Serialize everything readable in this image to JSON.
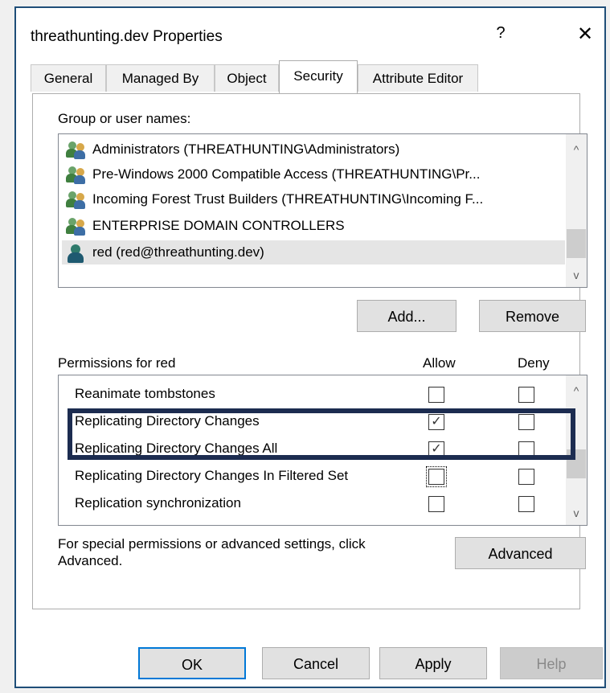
{
  "window": {
    "title": "threathunting.dev Properties",
    "help_glyph": "?",
    "close_glyph": "✕"
  },
  "tabs": [
    {
      "label": "General"
    },
    {
      "label": "Managed By"
    },
    {
      "label": "Object"
    },
    {
      "label": "Security"
    },
    {
      "label": "Attribute Editor"
    }
  ],
  "active_tab": "Security",
  "security": {
    "group_label": "Group or user names:",
    "principals": [
      {
        "name": "Administrators (THREATHUNTING\\Administrators)",
        "icon": "group-icon"
      },
      {
        "name": "Pre-Windows 2000 Compatible Access (THREATHUNTING\\Pr...",
        "icon": "group-icon"
      },
      {
        "name": "Incoming Forest Trust Builders (THREATHUNTING\\Incoming F...",
        "icon": "group-icon"
      },
      {
        "name": "ENTERPRISE DOMAIN CONTROLLERS",
        "icon": "group-icon"
      },
      {
        "name": "red (red@threathunting.dev)",
        "icon": "user-icon"
      }
    ],
    "add_label": "Add...",
    "remove_label": "Remove",
    "permissions_label": "Permissions for red",
    "allow_header": "Allow",
    "deny_header": "Deny",
    "permissions": [
      {
        "name": "Reanimate tombstones",
        "allow": false,
        "deny": false
      },
      {
        "name": "Replicating Directory Changes",
        "allow": true,
        "deny": false
      },
      {
        "name": "Replicating Directory Changes All",
        "allow": true,
        "deny": false
      },
      {
        "name": "Replicating Directory Changes In Filtered Set",
        "allow": false,
        "deny": false
      },
      {
        "name": "Replication synchronization",
        "allow": false,
        "deny": false
      }
    ],
    "advanced_note": "For special permissions or advanced settings, click Advanced.",
    "advanced_label": "Advanced"
  },
  "buttons": {
    "ok": "OK",
    "cancel": "Cancel",
    "apply": "Apply",
    "help": "Help"
  },
  "scroll_glyphs": {
    "up": "^",
    "down": "v"
  },
  "check_glyph": "✓",
  "colors": {
    "focus_border": "#0078d7",
    "highlight_box": "#1c2c50"
  }
}
